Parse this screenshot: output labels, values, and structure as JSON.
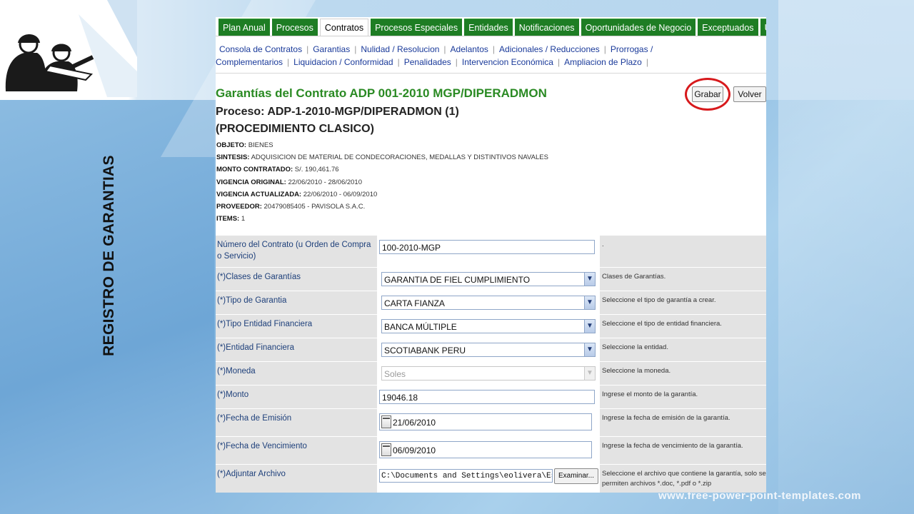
{
  "slide": {
    "vertical_title": "REGISTRO DE GARANTIAS",
    "footer_url": "www.free-power-point-templates.com"
  },
  "tabs": [
    {
      "label": "Plan Anual"
    },
    {
      "label": "Procesos"
    },
    {
      "label": "Contratos",
      "active": true
    },
    {
      "label": "Procesos Especiales"
    },
    {
      "label": "Entidades"
    },
    {
      "label": "Notificaciones"
    },
    {
      "label": "Oportunidades de Negocio"
    },
    {
      "label": "Exceptuados"
    },
    {
      "label": "Usuarios"
    }
  ],
  "subnav": [
    "Consola de Contratos",
    "Garantias",
    "Nulidad / Resolucion",
    "Adelantos",
    "Adicionales / Reducciones",
    "Prorrogas / Complementarios",
    "Liquidacion / Conformidad",
    "Penalidades",
    "Intervencion Económica",
    "Ampliacion de Plazo"
  ],
  "header": {
    "title": "Garantías del Contrato ADP 001-2010 MGP/DIPERADMON",
    "proceso": "Proceso: ADP-1-2010-MGP/DIPERADMON (1)",
    "procedimiento": "(PROCEDIMIENTO CLASICO)",
    "grabar": "Grabar",
    "volver": "Volver"
  },
  "info": {
    "objeto_label": "OBJETO:",
    "objeto": "BIENES",
    "sintesis_label": "SINTESIS:",
    "sintesis": "ADQUISICION DE MATERIAL DE CONDECORACIONES, MEDALLAS Y DISTINTIVOS NAVALES",
    "monto_label": "MONTO CONTRATADO:",
    "monto": "S/.  190,461.76",
    "vig_orig_label": "VIGENCIA ORIGINAL:",
    "vig_orig": "22/06/2010 - 28/06/2010",
    "vig_act_label": "VIGENCIA ACTUALIZADA:",
    "vig_act": "22/06/2010 - 06/09/2010",
    "proveedor_label": "PROVEEDOR:",
    "proveedor": "20479085405 - PAVISOLA S.A.C.",
    "items_label": "ITEMS:",
    "items": "1"
  },
  "form": {
    "numero": {
      "label": "Número del Contrato (u Orden de Compra o Servicio)",
      "value": "100-2010-MGP",
      "hint": "."
    },
    "clases": {
      "label": "(*)Clases de Garantías",
      "value": "GARANTIA DE FIEL CUMPLIMIENTO",
      "hint": "Clases de Garantías."
    },
    "tipo": {
      "label": "(*)Tipo de Garantia",
      "value": "CARTA FIANZA",
      "hint": "Seleccione el tipo de garantía a crear."
    },
    "tipo_entidad": {
      "label": "(*)Tipo Entidad Financiera",
      "value": "BANCA MÚLTIPLE",
      "hint": "Seleccione el tipo de entidad financiera."
    },
    "entidad": {
      "label": "(*)Entidad Financiera",
      "value": "SCOTIABANK PERU",
      "hint": "Seleccione la entidad."
    },
    "moneda": {
      "label": "(*)Moneda",
      "value": "Soles",
      "hint": "Seleccione la moneda."
    },
    "monto": {
      "label": "(*)Monto",
      "value": "19046.18",
      "hint": "Ingrese el monto de la garantía."
    },
    "fecha_emision": {
      "label": "(*)Fecha de Emisión",
      "value": "21/06/2010",
      "hint": "Ingrese la fecha de emisión de la garantía."
    },
    "fecha_venc": {
      "label": "(*)Fecha de Vencimiento",
      "value": "06/09/2010",
      "hint": "Ingrese la fecha de vencimiento de la garantía."
    },
    "archivo": {
      "label": "(*)Adjuntar Archivo",
      "value": "C:\\Documents and Settings\\eolivera\\Escritorio\\E",
      "button": "Examinar...",
      "hint": "Seleccione el archivo que contiene la garantía, solo se permiten archivos *.doc, *.pdf o *.zip"
    }
  }
}
